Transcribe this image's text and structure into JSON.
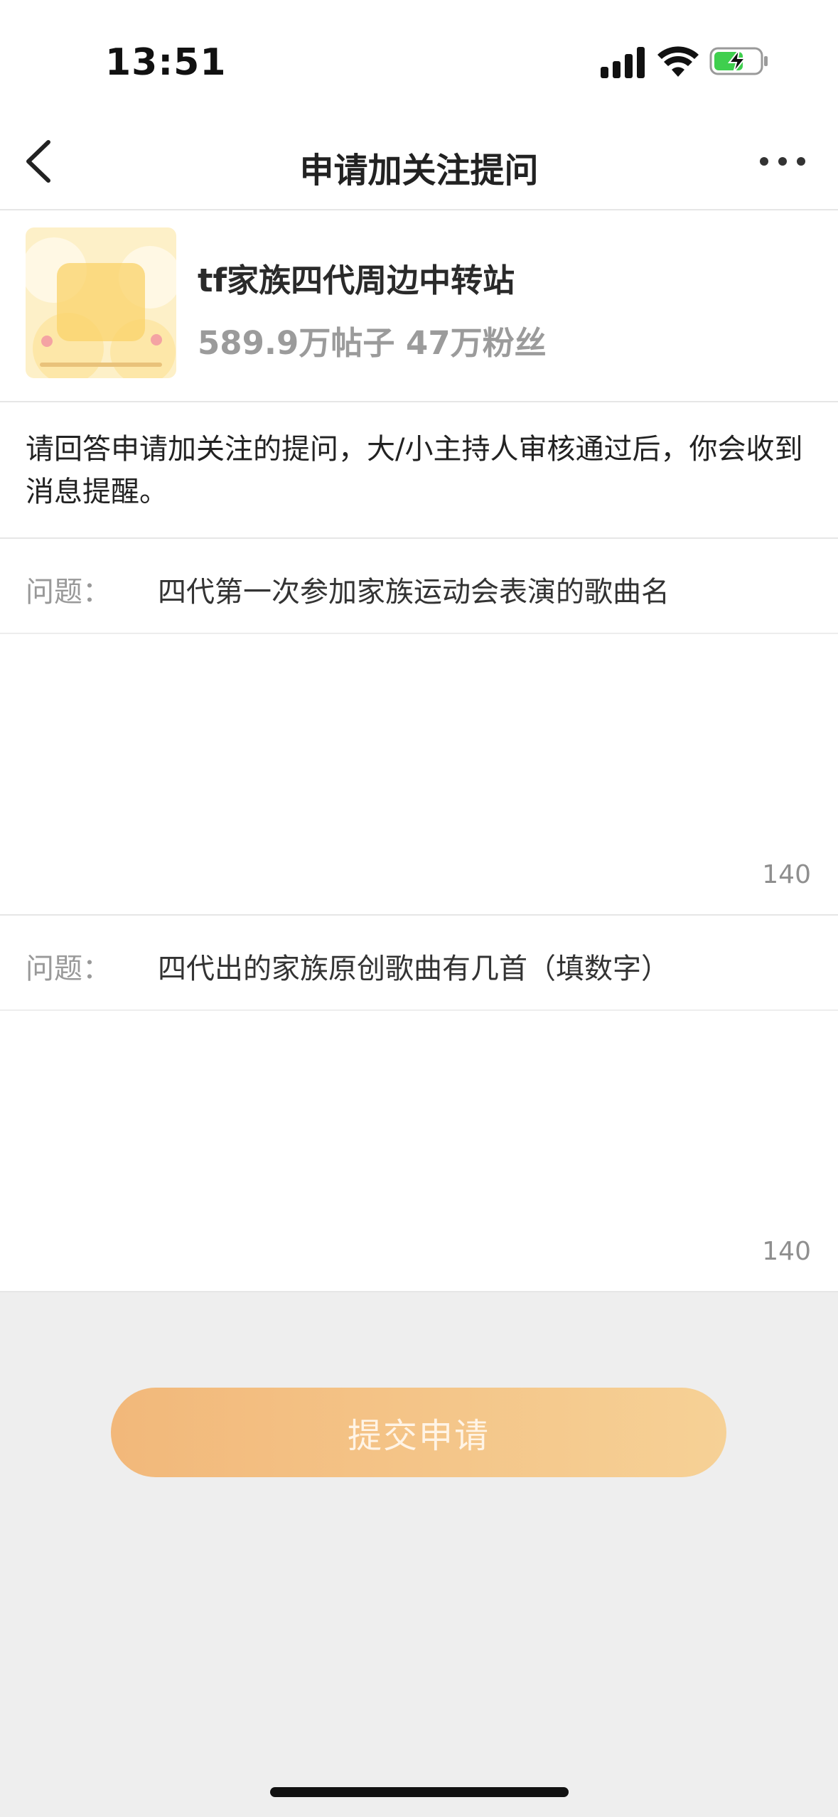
{
  "status_bar": {
    "time": "13:51"
  },
  "nav": {
    "title": "申请加关注提问"
  },
  "forum": {
    "name": "tf家族四代周边中转站",
    "stats": "589.9万帖子 47万粉丝"
  },
  "notice": "请回答申请加关注的提问，大/小主持人审核通过后，你会收到消息提醒。",
  "questions": [
    {
      "label": "问题：",
      "text": "四代第一次参加家族运动会表演的歌曲名",
      "answer": "",
      "counter": "140"
    },
    {
      "label": "问题：",
      "text": "四代出的家族原创歌曲有几首（填数字）",
      "answer": "",
      "counter": "140"
    }
  ],
  "submit_label": "提交申请",
  "colors": {
    "accent_start": "#f2b87a",
    "accent_end": "#f6d196",
    "background": "#eeeeee"
  },
  "icons": [
    "back-chevron-icon",
    "more-dots-icon",
    "cellular-signal-icon",
    "wifi-icon",
    "battery-charging-icon"
  ]
}
